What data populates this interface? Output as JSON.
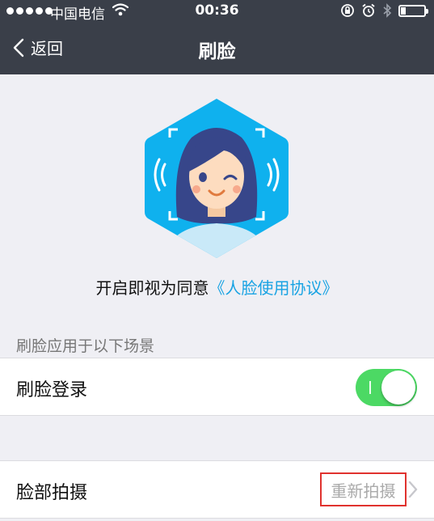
{
  "status_bar": {
    "carrier": "中国电信",
    "time": "00:36",
    "signal_icon": "signal-dots-icon",
    "wifi_icon": "wifi-icon",
    "battery_level": 0.2
  },
  "nav": {
    "back_label": "返回",
    "title": "刷脸"
  },
  "hero": {
    "icon": "face-hexagon-illustration"
  },
  "agreement": {
    "prefix": "开启即视为同意",
    "link": "《人脸使用协议》"
  },
  "section": {
    "caption": "刷脸应用于以下场景"
  },
  "face_login": {
    "label": "刷脸登录",
    "enabled": true
  },
  "face_capture": {
    "label": "脸部拍摄",
    "action": "重新拍摄"
  },
  "colors": {
    "nav_bg": "#3a3f49",
    "accent": "#19a3e3",
    "toggle_on": "#4cd964",
    "highlight_border": "#e0322e",
    "page_bg": "#efeff4"
  }
}
